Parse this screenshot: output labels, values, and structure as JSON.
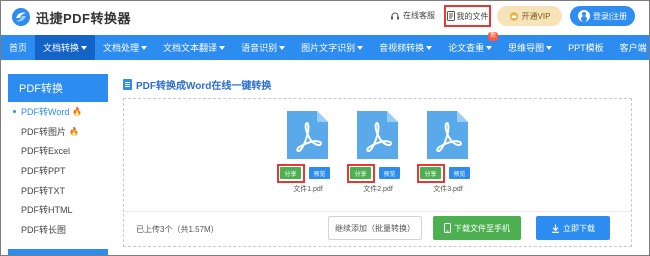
{
  "header": {
    "brand": "迅捷PDF转换器",
    "online_service": "在线客服",
    "my_files": "我的文件",
    "vip": "开通VIP",
    "login": "登录|注册"
  },
  "nav": {
    "items": [
      {
        "label": "首页",
        "active": false,
        "caret": false,
        "badge": ""
      },
      {
        "label": "文档转换",
        "active": true,
        "caret": true,
        "badge": ""
      },
      {
        "label": "文档处理",
        "active": false,
        "caret": true,
        "badge": ""
      },
      {
        "label": "文档文本翻译",
        "active": false,
        "caret": true,
        "badge": ""
      },
      {
        "label": "语音识别",
        "active": false,
        "caret": true,
        "badge": ""
      },
      {
        "label": "图片文字识别",
        "active": false,
        "caret": true,
        "badge": ""
      },
      {
        "label": "音视频转换",
        "active": false,
        "caret": true,
        "badge": ""
      },
      {
        "label": "论文查重",
        "active": false,
        "caret": true,
        "badge": "新"
      },
      {
        "label": "思维导图",
        "active": false,
        "caret": true,
        "badge": ""
      },
      {
        "label": "PPT模板",
        "active": false,
        "caret": false,
        "badge": ""
      },
      {
        "label": "客户端",
        "active": false,
        "caret": true,
        "badge": ""
      }
    ]
  },
  "sidebar": {
    "title": "PDF转换",
    "items": [
      {
        "label": "PDF转Word",
        "hot": true,
        "active": true
      },
      {
        "label": "PDF转图片",
        "hot": true,
        "active": false
      },
      {
        "label": "PDF转Excel",
        "hot": false,
        "active": false
      },
      {
        "label": "PDF转PPT",
        "hot": false,
        "active": false
      },
      {
        "label": "PDF转TXT",
        "hot": false,
        "active": false
      },
      {
        "label": "PDF转HTML",
        "hot": false,
        "active": false
      },
      {
        "label": "PDF转长图",
        "hot": false,
        "active": false
      }
    ]
  },
  "main": {
    "title": "PDF转换成Word在线一键转换",
    "files": [
      {
        "name": "文件1.pdf",
        "share": "分享",
        "preview": "预览"
      },
      {
        "name": "文件2.pdf",
        "share": "分享",
        "preview": "预览"
      },
      {
        "name": "文件3.pdf",
        "share": "分享",
        "preview": "预览"
      }
    ],
    "count_text": "已上传3个（共1.57M）",
    "continue_label": "继续添加（批量转换）",
    "download_phone_label": "下载文件至手机",
    "download_label": "立即下载"
  },
  "colors": {
    "primary": "#2d8cf0",
    "nav_active": "#1464c8",
    "green": "#4caf50",
    "highlight_red": "#e53935",
    "vip_bg": "#f7e3b8"
  }
}
